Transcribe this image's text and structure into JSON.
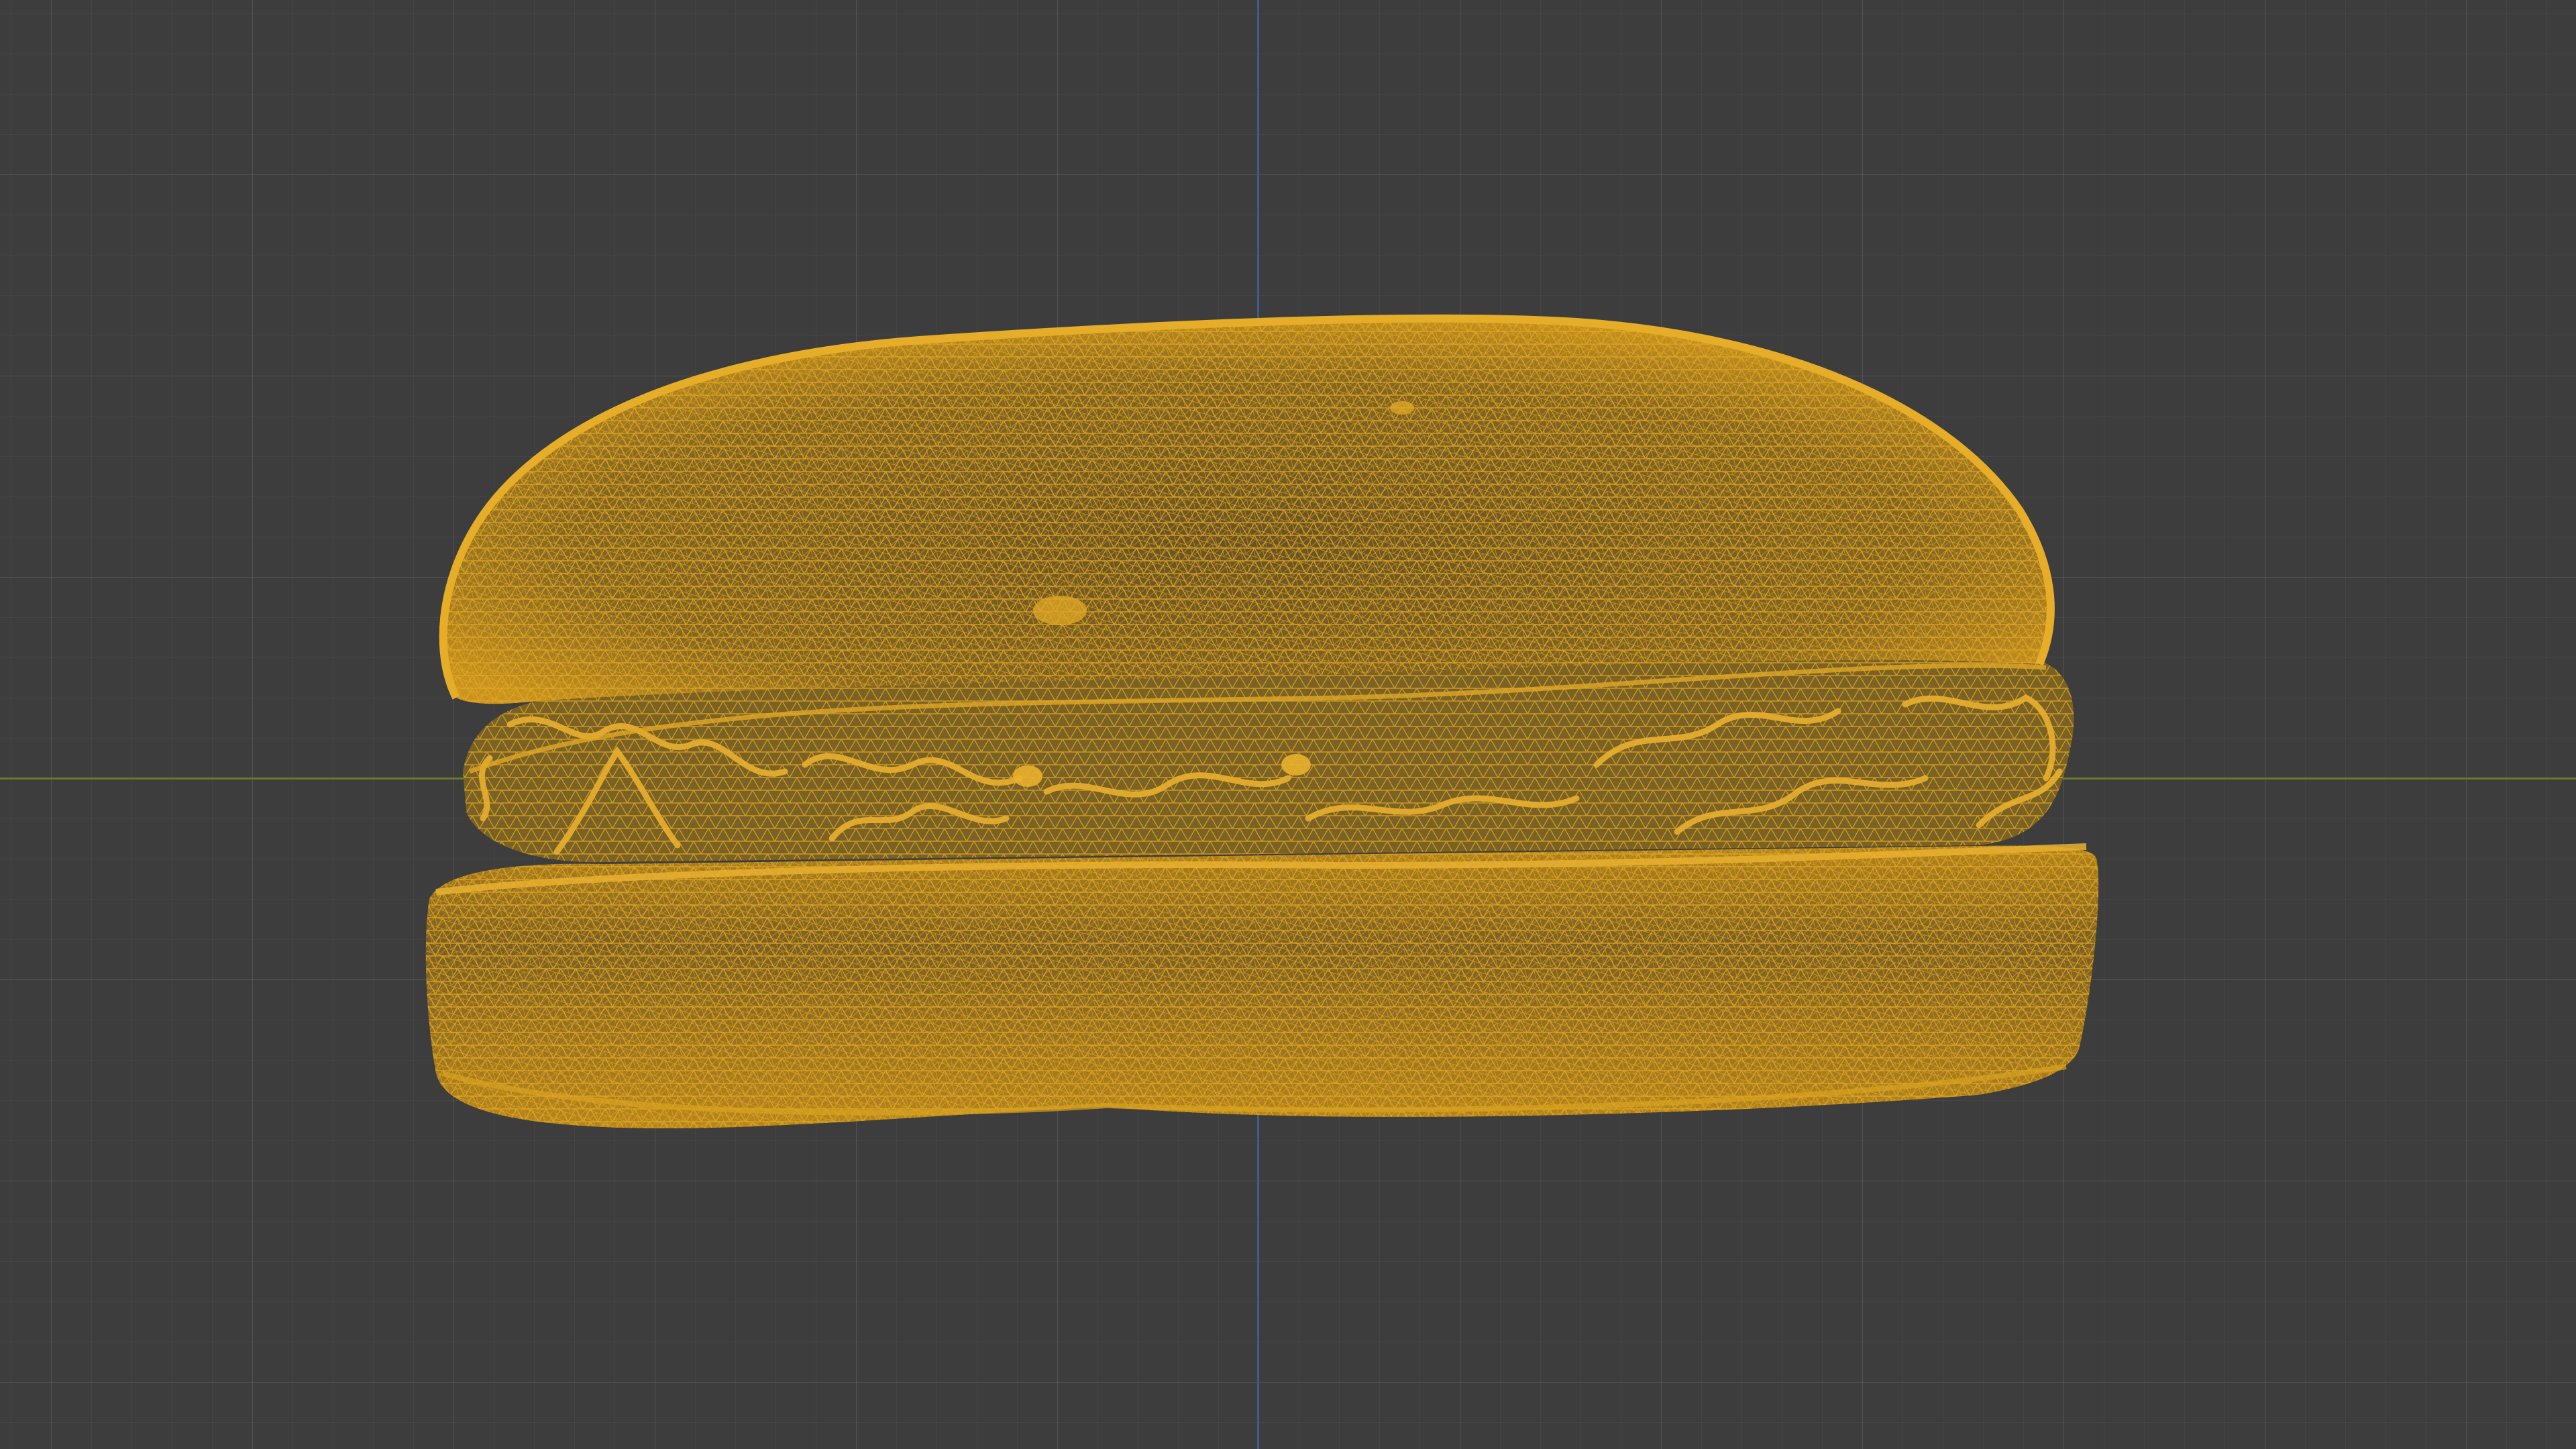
{
  "viewport": {
    "background_color": "#3d3d3d",
    "grid_color": "#4a4a4a",
    "x_axis_color": "#6b7a2a",
    "z_axis_color": "#3e5c8a"
  },
  "object": {
    "name": "burger-mesh",
    "display": "wireframe",
    "wire_color": "#d9a21f",
    "fill_color": "#a87a1a"
  }
}
